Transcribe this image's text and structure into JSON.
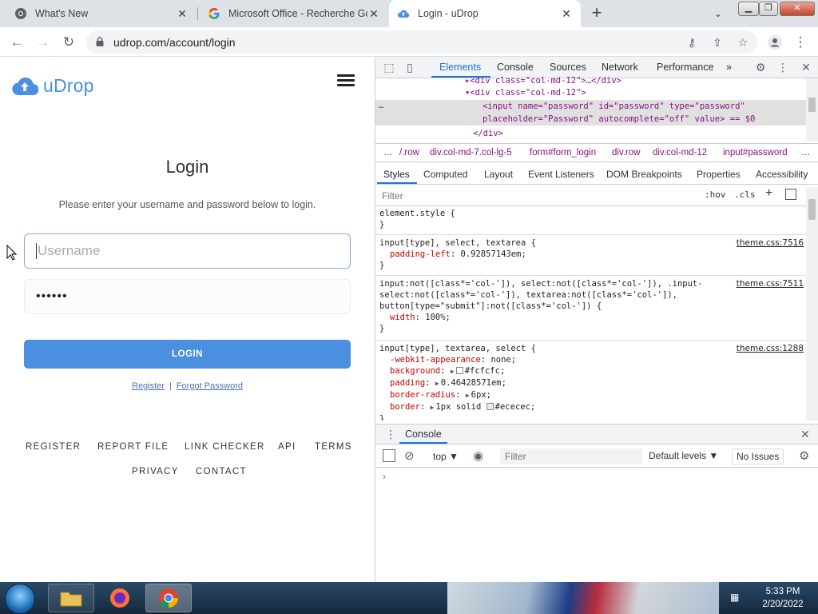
{
  "browser": {
    "tabs": [
      {
        "title": "What's New",
        "active": false
      },
      {
        "title": "Microsoft Office - Recherche Goo",
        "active": false
      },
      {
        "title": "Login - uDrop",
        "active": true
      }
    ],
    "url": "udrop.com/account/login"
  },
  "page": {
    "brand": "uDrop",
    "title": "Login",
    "subtitle": "Please enter your username and password below to login.",
    "username_placeholder": "Username",
    "password_value": "••••••",
    "login_button": "LOGIN",
    "register_link": "Register",
    "forgot_link": "Forgot Password",
    "link_sep": "|",
    "footer": {
      "register": "REGISTER",
      "report_file": "REPORT FILE",
      "link_checker": "LINK CHECKER",
      "api": "API",
      "terms": "TERMS",
      "privacy": "PRIVACY",
      "contact": "CONTACT"
    }
  },
  "devtools": {
    "tabs": {
      "elements": "Elements",
      "console": "Console",
      "sources": "Sources",
      "network": "Network",
      "performance": "Performance",
      "more": "»"
    },
    "dom": {
      "line0": "▸<div class=\"col-md-12\">…</div>",
      "line1_open": "▾<div class=\"col-md-12\">",
      "sel_a": "<input name=\"password\" id=\"password\" type=\"password\"",
      "sel_b": "placeholder=\"Password\" autocomplete=\"off\" value> == $0",
      "close": "</div>",
      "dots": "…"
    },
    "breadcrumbs": {
      "ellipsis": "…",
      "c1": "/.row",
      "c2": "div.col-md-7.col-lg-5",
      "c3": "form#form_login",
      "c4": "div.row",
      "c5": "div.col-md-12",
      "c6": "input#password",
      "c7": "…"
    },
    "subtabs": {
      "styles": "Styles",
      "computed": "Computed",
      "layout": "Layout",
      "listeners": "Event Listeners",
      "dom_bp": "DOM Breakpoints",
      "properties": "Properties",
      "accessibility": "Accessibility"
    },
    "filter": {
      "placeholder": "Filter",
      "hov": ":hov",
      "cls": ".cls",
      "plus": "+"
    },
    "rules": {
      "r0_sel": "element.style {",
      "r0_close": "}",
      "r1_sel": "input[type], select, textarea {",
      "r1_src": "theme.css:7516",
      "r1_p1_name": "padding-left",
      "r1_p1_val": "0.92857143em;",
      "r1_close": "}",
      "r2_sel_a": "input:not([class*='col-']), select:not([class*='col-']), .input-",
      "r2_sel_b": "select:not([class*='col-']), textarea:not([class*='col-']),",
      "r2_sel_c": "button[type=\"submit\"]:not([class*='col-']) {",
      "r2_src": "theme.css:7511",
      "r2_p1_name": "width",
      "r2_p1_val": "100%;",
      "r2_close": "}",
      "r3_sel": "input[type], textarea, select {",
      "r3_src": "theme.css:1288",
      "r3_p1_name": "-webkit-appearance",
      "r3_p1_val": "none;",
      "r3_p2_name": "background",
      "r3_p2_val": "#fcfcfc;",
      "r3_p3_name": "padding",
      "r3_p3_val": "0.46428571em;",
      "r3_p4_name": "border-radius",
      "r3_p4_val": "6px;",
      "r3_p5_name": "border",
      "r3_p5_val": "1px solid",
      "r3_p5_color": "#ececec;",
      "r3_close": "}"
    },
    "console": {
      "drawer_title": "Console",
      "context": "top ▼",
      "filter_placeholder": "Filter",
      "levels": "Default levels ▼",
      "issues": "No Issues",
      "prompt": "›"
    }
  },
  "taskbar": {
    "time": "5:33 PM",
    "date": "2/20/2022"
  },
  "colors": {
    "brand_blue": "#4a8fe0",
    "devtools_accent": "#1a73e8"
  }
}
